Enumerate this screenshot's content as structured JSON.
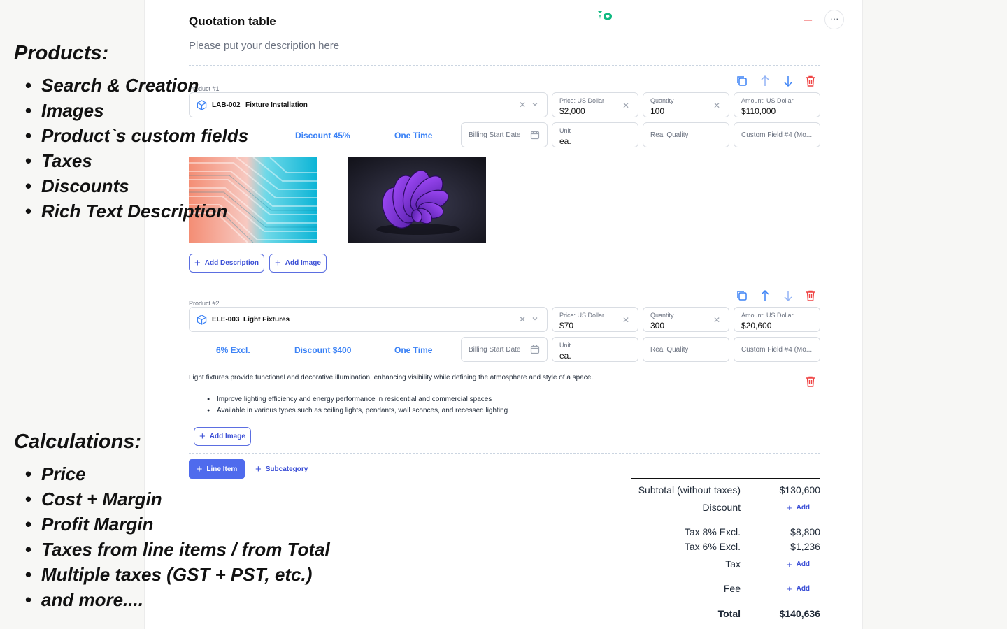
{
  "overlay": {
    "products_title": "Products:",
    "products_items": [
      "Search & Creation",
      "Images",
      "Product`s custom fields",
      "Taxes",
      "Discounts",
      "Rich Text Description"
    ],
    "calc_title": "Calculations:",
    "calc_items": [
      "Price",
      "Cost + Margin",
      "Profit Margin",
      "Taxes from line  items / from Total",
      "Multiple taxes (GST + PST, etc.)",
      "and more...."
    ]
  },
  "header": {
    "title": "Quotation table",
    "description_placeholder": "Please put your description here",
    "more_label": "···",
    "minus_label": "–"
  },
  "products": [
    {
      "label": "Product #1",
      "sku": "LAB-002",
      "name": "Fixture Installation",
      "price_label": "Price: US Dollar",
      "price": "$2,000",
      "quantity_label": "Quantity",
      "quantity": "100",
      "amount_label": "Amount: US Dollar",
      "amount": "$110,000",
      "tax_link": "",
      "discount_link": "Discount 45%",
      "billing_link": "One Time",
      "billing_start_placeholder": "Billing Start Date",
      "unit_label": "Unit",
      "unit": "ea.",
      "custom3_placeholder": "Real Quality",
      "custom4_placeholder": "Custom Field #4 (Mo..."
    },
    {
      "label": "Product #2",
      "sku": "ELE-003",
      "name": "Light Fixtures",
      "price_label": "Price: US Dollar",
      "price": "$70",
      "quantity_label": "Quantity",
      "quantity": "300",
      "amount_label": "Amount: US Dollar",
      "amount": "$20,600",
      "tax_link": "6% Excl.",
      "discount_link": "Discount $400",
      "billing_link": "One Time",
      "billing_start_placeholder": "Billing Start Date",
      "unit_label": "Unit",
      "unit": "ea.",
      "custom3_placeholder": "Real Quality",
      "custom4_placeholder": "Custom Field #4 (Mo...",
      "description": "Light fixtures provide functional and decorative illumination, enhancing visibility while defining the atmosphere and style of a space.",
      "bullets": [
        "Improve lighting efficiency and energy performance in residential and commercial spaces",
        "Available in various types such as ceiling lights, pendants, wall sconces, and recessed lighting"
      ]
    }
  ],
  "buttons": {
    "add_description": "Add Description",
    "add_image": "Add Image",
    "line_item": "Line Item",
    "subcategory": "Subcategory",
    "add": "Add"
  },
  "totals": {
    "subtotal_label": "Subtotal (without taxes)",
    "subtotal": "$130,600",
    "discount_label": "Discount",
    "tax1_label": "Tax 8% Excl.",
    "tax1": "$8,800",
    "tax2_label": "Tax 6% Excl.",
    "tax2": "$1,236",
    "tax_label": "Tax",
    "fee_label": "Fee",
    "total_label": "Total",
    "total": "$140,636"
  },
  "colors": {
    "accent": "#4f6bed",
    "link": "#3b82f6",
    "danger": "#ef4444"
  }
}
